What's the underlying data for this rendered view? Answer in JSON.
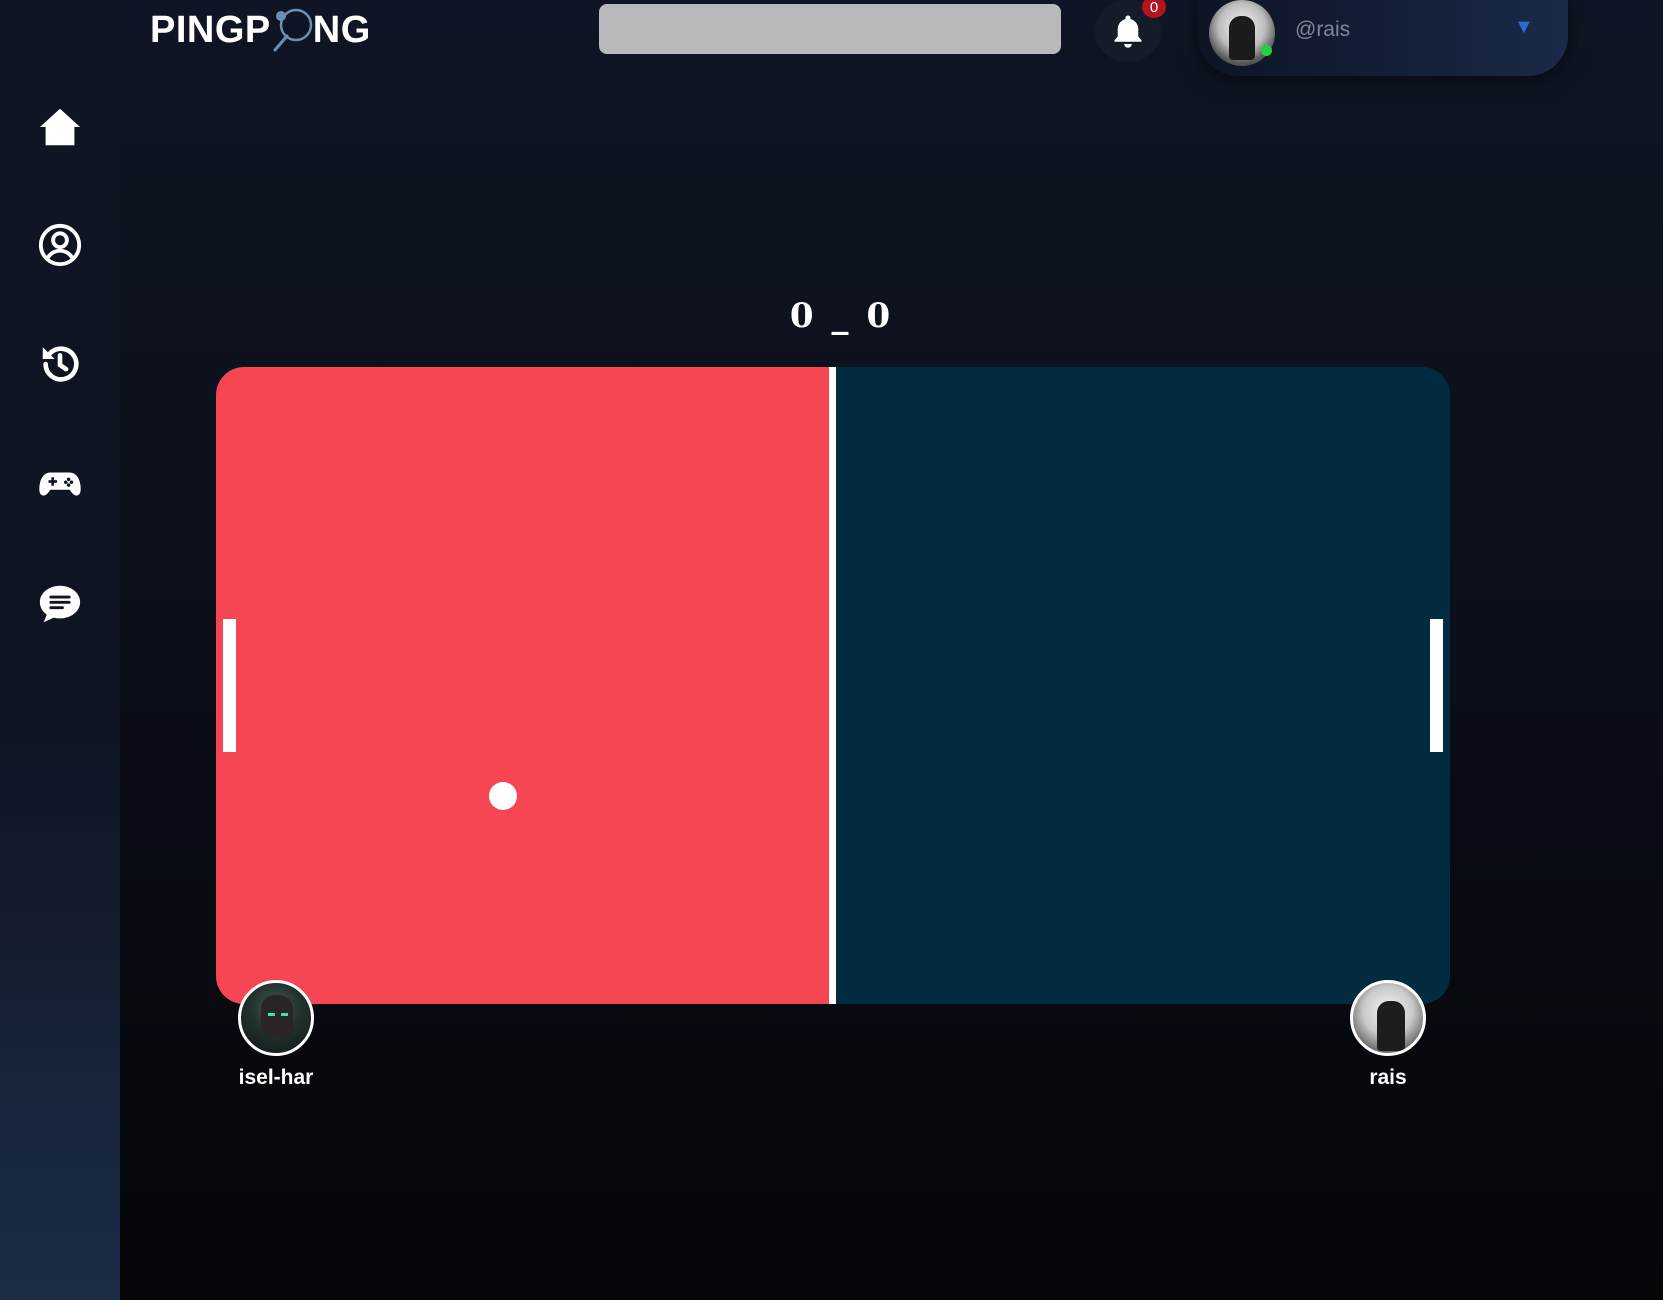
{
  "app": {
    "logo_prefix": "PINGP",
    "logo_suffix": "NG"
  },
  "search": {
    "value": "",
    "placeholder": ""
  },
  "notifications": {
    "count": "0"
  },
  "user": {
    "handle": "@rais",
    "status": "online",
    "menu_chevron": "▼"
  },
  "sidebar": {
    "items": [
      {
        "icon": "home-icon"
      },
      {
        "icon": "profile-icon"
      },
      {
        "icon": "history-icon"
      },
      {
        "icon": "game-controller-icon"
      },
      {
        "icon": "chat-icon"
      }
    ]
  },
  "game": {
    "score_left": "0",
    "score_separator": "_",
    "score_right": "0",
    "colors": {
      "left_half": "#f74653",
      "right_half": "#022b3f",
      "net": "#ffffff",
      "paddle": "#ffffff",
      "ball": "#ffffff"
    }
  },
  "players": {
    "left": {
      "name": "isel-har"
    },
    "right": {
      "name": "rais"
    }
  }
}
